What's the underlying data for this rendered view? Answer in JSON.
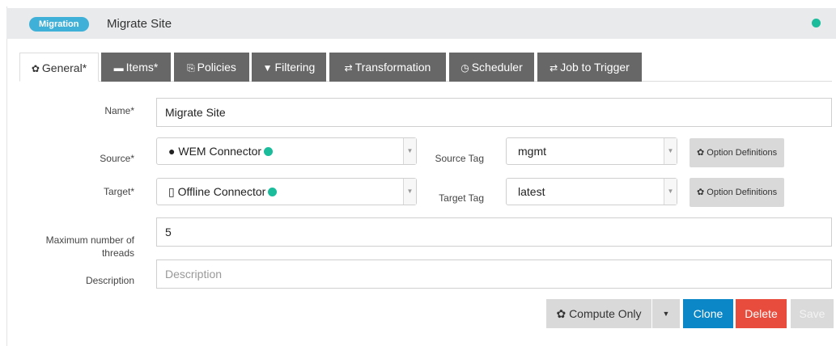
{
  "header": {
    "badge": "Migration",
    "title": "Migrate Site",
    "status_color": "#1abc9c"
  },
  "tabs": [
    {
      "label": "General*",
      "icon": "gear-icon",
      "glyph": "✿",
      "active": true
    },
    {
      "label": "Items*",
      "icon": "archive-icon",
      "glyph": "▬",
      "active": false
    },
    {
      "label": "Policies",
      "icon": "copy-icon",
      "glyph": "⎘",
      "active": false
    },
    {
      "label": "Filtering",
      "icon": "filter-icon",
      "glyph": "▼",
      "active": false
    },
    {
      "label": "Transformation",
      "icon": "exchange-icon",
      "glyph": "⇄",
      "active": false
    },
    {
      "label": "Scheduler",
      "icon": "clock-icon",
      "glyph": "◷",
      "active": false
    },
    {
      "label": "Job to Trigger",
      "icon": "exchange-icon",
      "glyph": "⇄",
      "active": false
    }
  ],
  "form": {
    "name_label": "Name*",
    "name_value": "Migrate Site",
    "source_label": "Source*",
    "source_value": "WEM Connector",
    "source_tag_label": "Source Tag",
    "source_tag_value": "mgmt",
    "target_label": "Target*",
    "target_value": "Offline Connector",
    "target_tag_label": "Target Tag",
    "target_tag_value": "latest",
    "option_definitions_label": "Option Definitions",
    "threads_label_line1": "Maximum number of",
    "threads_label_line2": "threads",
    "threads_value": "5",
    "description_label": "Description",
    "description_placeholder": "Description"
  },
  "actions": {
    "compute_only": "Compute Only",
    "clone": "Clone",
    "delete": "Delete",
    "save": "Save"
  },
  "colors": {
    "accent": "#3fb0d7",
    "status": "#1abc9c",
    "clone": "#0b86c6",
    "delete": "#e84c3d",
    "tab_inactive": "#676767"
  }
}
